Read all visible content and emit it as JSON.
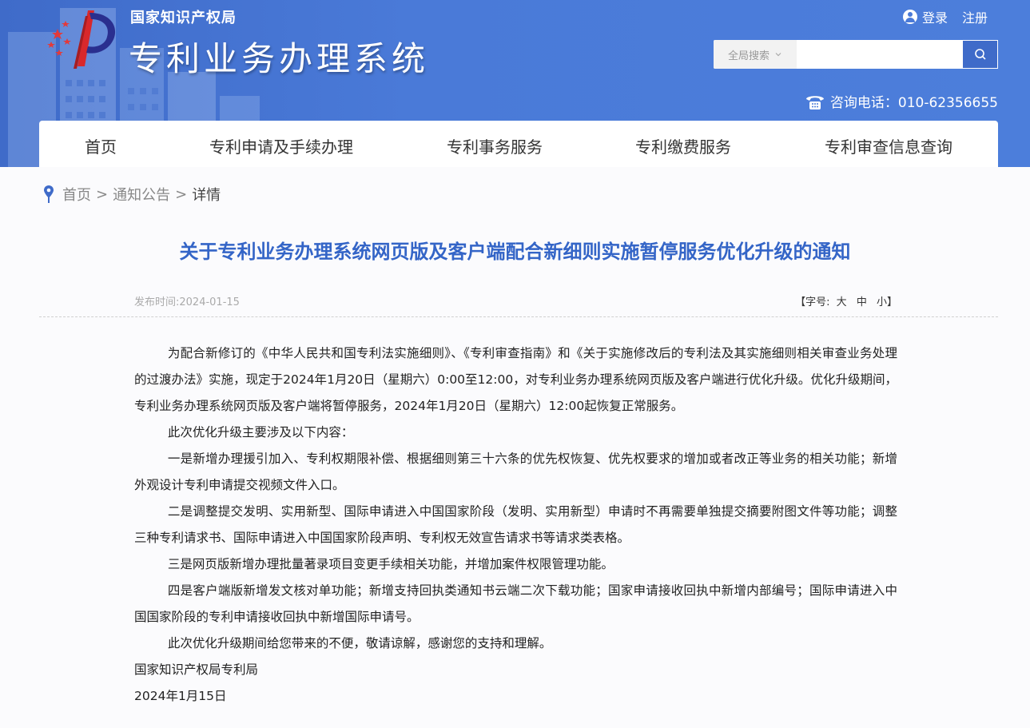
{
  "header": {
    "org_name": "国家知识产权局",
    "system_name": "专利业务办理系统",
    "login": "登录",
    "register": "注册",
    "search_scope": "全局搜索",
    "search_placeholder": "",
    "phone": "咨询电话：010-62356655"
  },
  "nav": {
    "items": [
      "首页",
      "专利申请及手续办理",
      "专利事务服务",
      "专利缴费服务",
      "专利审查信息查询"
    ]
  },
  "breadcrumb": {
    "home": "首页",
    "sep1": ">",
    "section": "通知公告",
    "sep2": ">",
    "current": "详情"
  },
  "article": {
    "title": "关于专利业务办理系统网页版及客户端配合新细则实施暂停服务优化升级的通知",
    "publish_time": "发布时间:2024-01-15",
    "fontsize_label": "【字号:",
    "fontsize_large": "大",
    "fontsize_medium": "中",
    "fontsize_small": "小】",
    "paragraphs": [
      "为配合新修订的《中华人民共和国专利法实施细则》、《专利审查指南》和《关于实施修改后的专利法及其实施细则相关审查业务处理的过渡办法》实施，现定于2024年1月20日（星期六）0:00至12:00，对专利业务办理系统网页版及客户端进行优化升级。优化升级期间，专利业务办理系统网页版及客户端将暂停服务，2024年1月20日（星期六）12:00起恢复正常服务。",
      "此次优化升级主要涉及以下内容：",
      "一是新增办理援引加入、专利权期限补偿、根据细则第三十六条的优先权恢复、优先权要求的增加或者改正等业务的相关功能；新增外观设计专利申请提交视频文件入口。",
      "二是调整提交发明、实用新型、国际申请进入中国国家阶段（发明、实用新型）申请时不再需要单独提交摘要附图文件等功能；调整三种专利请求书、国际申请进入中国国家阶段声明、专利权无效宣告请求书等请求类表格。",
      "三是网页版新增办理批量著录项目变更手续相关功能，并增加案件权限管理功能。",
      "四是客户端版新增发文核对单功能；新增支持回执类通知书云端二次下载功能；国家申请接收回执中新增内部编号；国际申请进入中国国家阶段的专利申请接收回执中新增国际申请号。",
      "此次优化升级期间给您带来的不便，敬请谅解，感谢您的支持和理解。"
    ],
    "signature": "国家知识产权局专利局",
    "sign_date": "2024年1月15日"
  },
  "colors": {
    "header_blue": "#4a7ad8",
    "title_blue": "#3465c7",
    "logo_red": "#d8282b"
  }
}
